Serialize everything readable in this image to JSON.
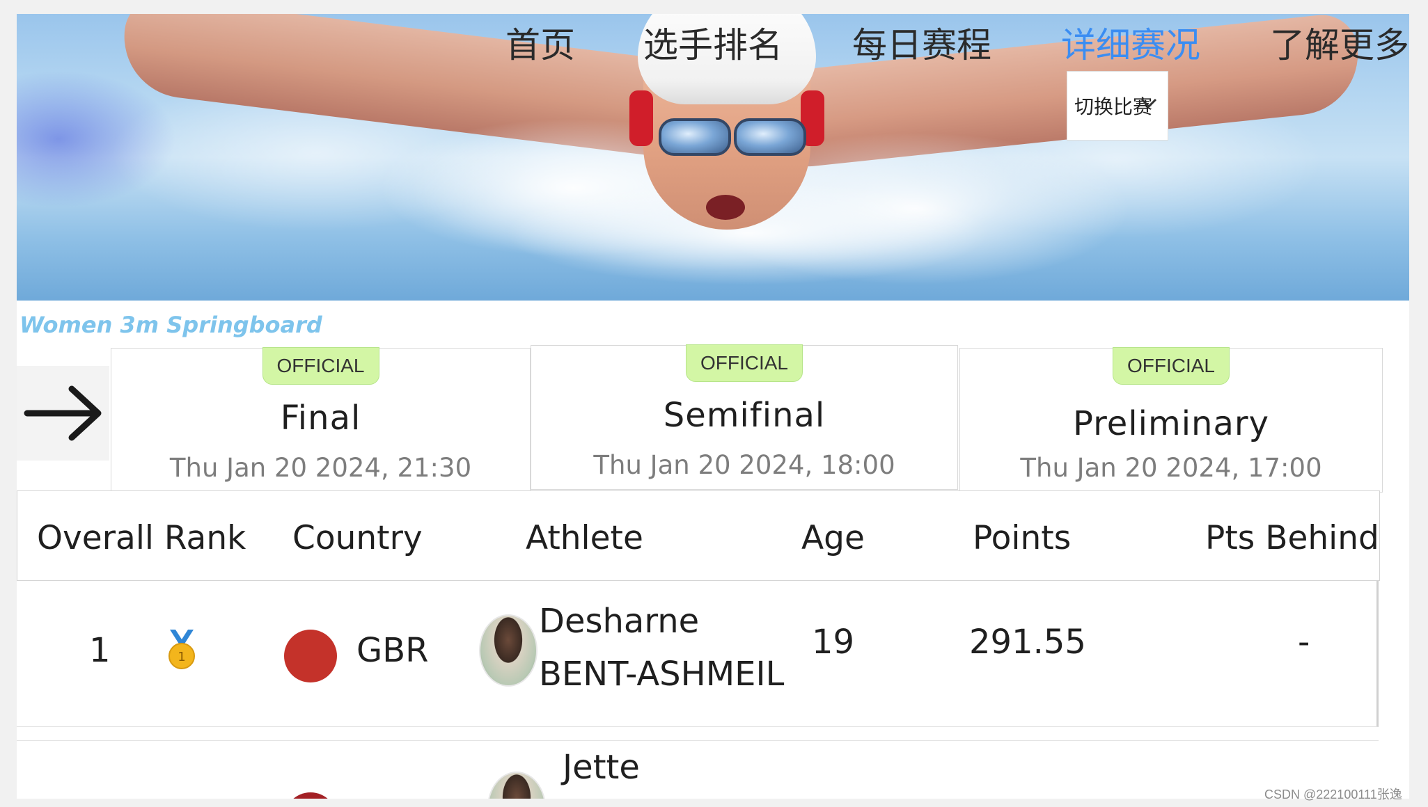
{
  "nav": {
    "items": [
      {
        "label": "首页",
        "active": false
      },
      {
        "label": "选手排名",
        "active": false
      },
      {
        "label": "每日赛程",
        "active": false
      },
      {
        "label": "详细赛况",
        "active": true
      },
      {
        "label": "了解更多",
        "active": false
      }
    ],
    "active_color": "#3b8df2",
    "dropdown": {
      "label": "切换比赛",
      "icon": "chevron-down-icon"
    }
  },
  "event": {
    "title": "Women 3m Springboard",
    "title_color": "#7ec4ec"
  },
  "phases": [
    {
      "status": "OFFICIAL",
      "name": "Final",
      "date": "Thu Jan 20 2024, 21:30"
    },
    {
      "status": "OFFICIAL",
      "name": "Semifinal",
      "date": "Thu Jan 20 2024, 18:00"
    },
    {
      "status": "OFFICIAL",
      "name": "Preliminary",
      "date": "Thu Jan 20 2024, 17:00"
    }
  ],
  "badge_color": "#d3f6a5",
  "table": {
    "headers": [
      "Overall Rank",
      "Country",
      "Athlete",
      "Age",
      "Points",
      "Pts Behind"
    ],
    "rows": [
      {
        "rank": "1",
        "medal": "gold-medal-icon",
        "medal_number": "1",
        "flag_color": "#c4322a",
        "country": "GBR",
        "athlete_first": "Desharne",
        "athlete_last": "BENT-ASHMEIL",
        "age": "19",
        "points": "291.55",
        "pts_behind": "-"
      },
      {
        "athlete_first": "Jette",
        "flag_color": "#a32025"
      }
    ]
  },
  "watermark": "CSDN @222100111张逸"
}
